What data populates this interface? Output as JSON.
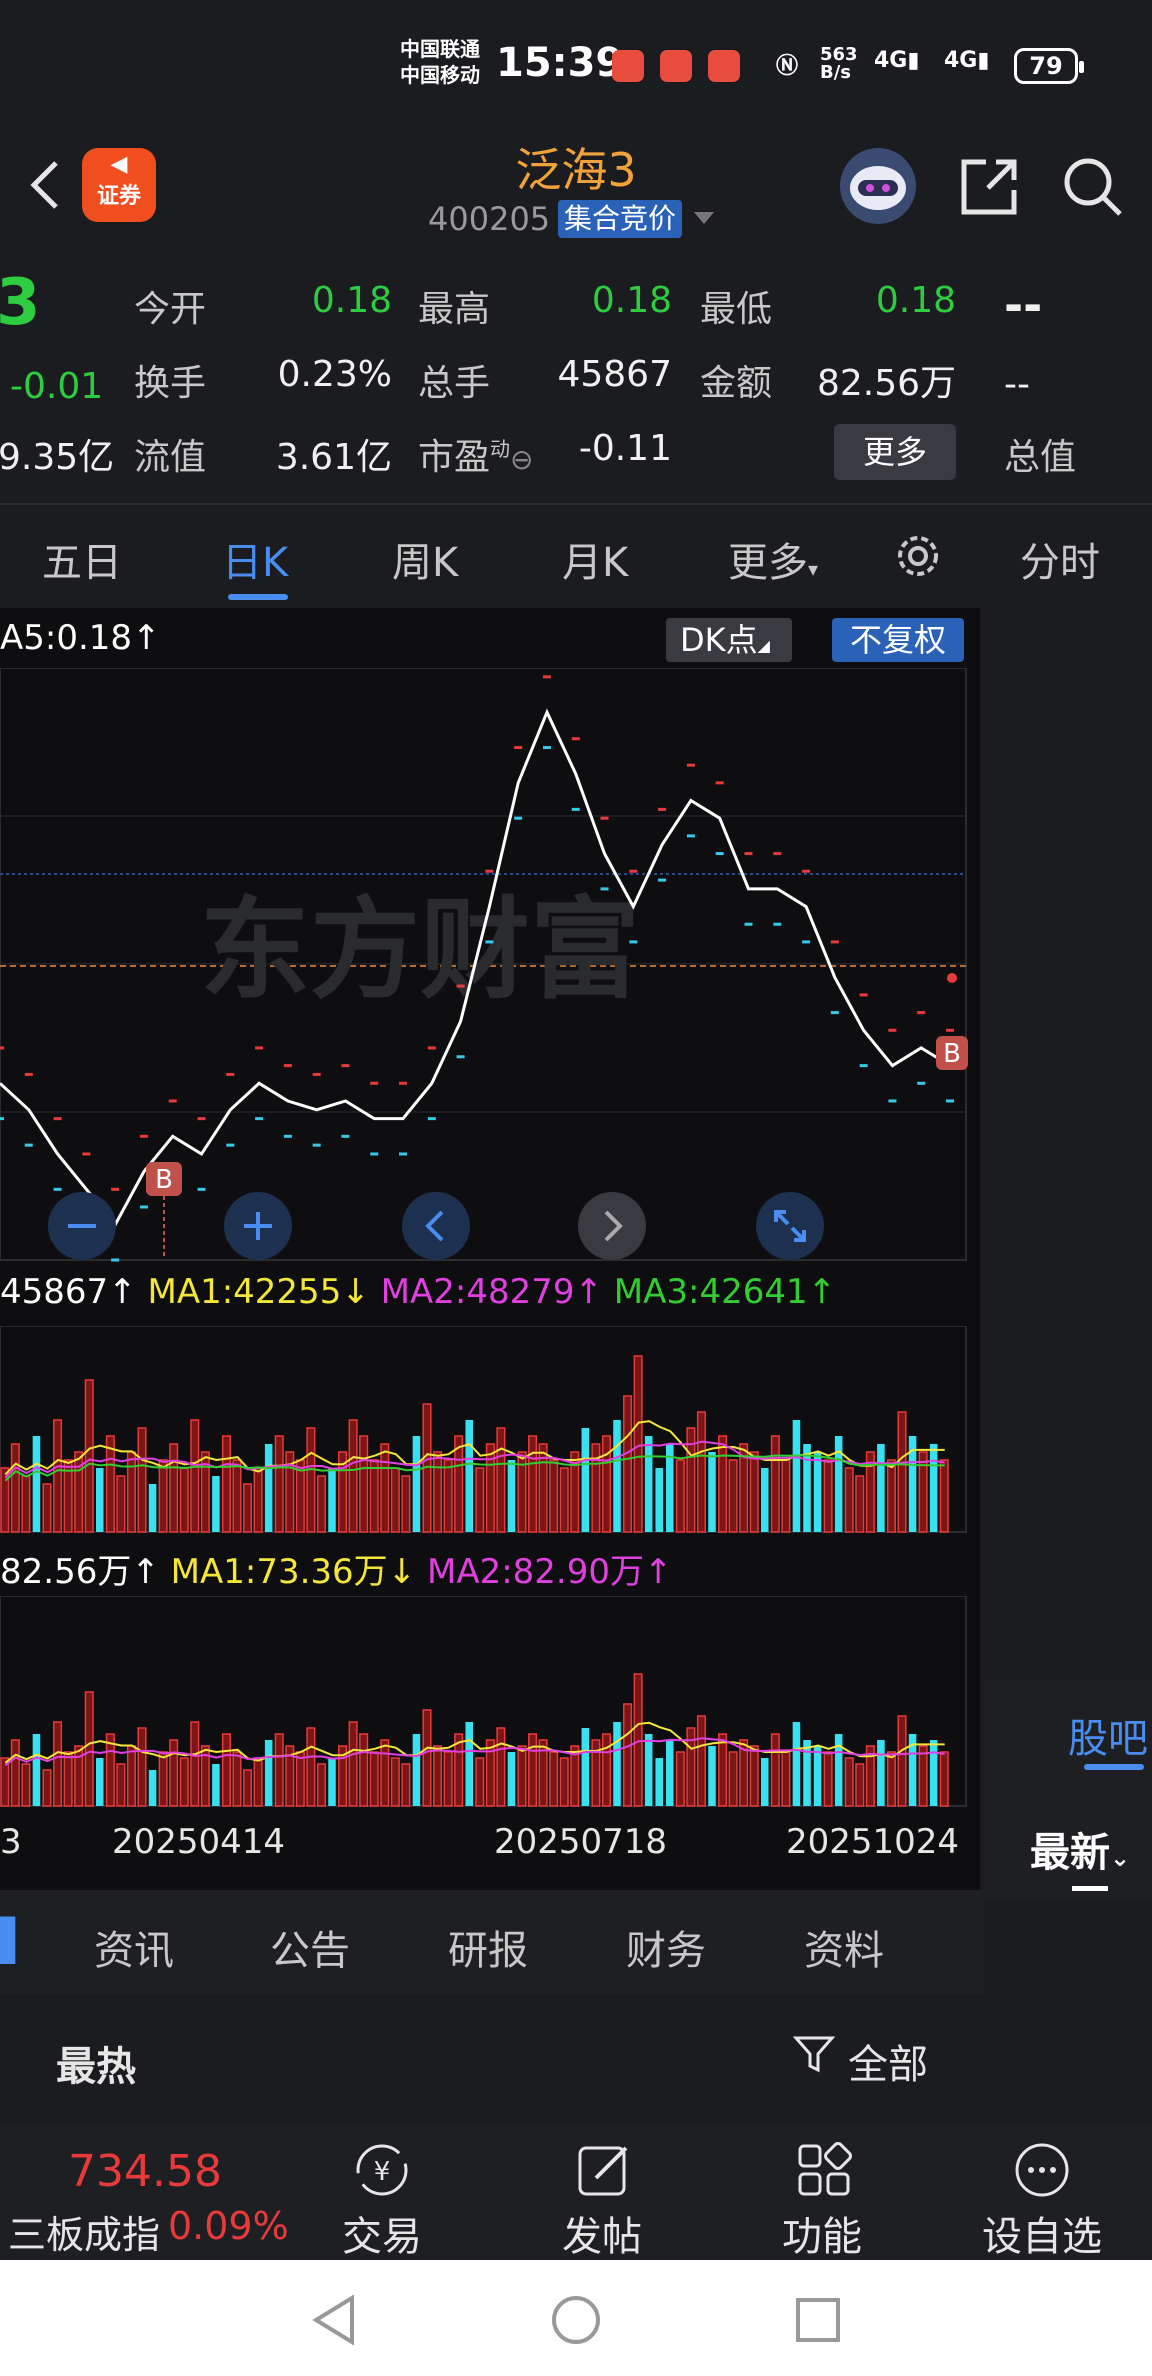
{
  "status_bar": {
    "carrier1": "中国联通",
    "carrier2": "中国移动",
    "time": "15:39",
    "net_speed_top": "563",
    "net_speed_bottom": "B/s",
    "signal1": "4G",
    "signal2": "4G",
    "battery": "79"
  },
  "header": {
    "app_logo_label": "证券",
    "stock_name": "泛海3",
    "stock_code": "400205",
    "stock_tag": "集合竞价"
  },
  "quote": {
    "price_partial": "3",
    "change_partial": "-0.01",
    "cap_partial": "9.35亿",
    "open_label": "今开",
    "open_value": "0.18",
    "high_label": "最高",
    "high_value": "0.18",
    "low_label": "最低",
    "low_value": "0.18",
    "turnover_label": "换手",
    "turnover_value": "0.23%",
    "volume_label": "总手",
    "volume_value": "45867",
    "amount_label": "金额",
    "amount_value": "82.56万",
    "float_label": "流值",
    "float_value": "3.61亿",
    "pe_label": "市盈",
    "pe_superscript": "动",
    "pe_value": "-0.11",
    "more_label": "更多",
    "right_top": "--",
    "right_mid": "--",
    "total_value_label": "总值"
  },
  "chart_tabs": {
    "tabs": [
      "五日",
      "日K",
      "周K",
      "月K",
      "更多",
      "分时"
    ],
    "active": "日K"
  },
  "kline": {
    "ma_line": "A5:0.18",
    "dk_label": "DK点",
    "fq_label": "不复权",
    "watermark": "东方财富",
    "buy_marker": "B",
    "close_values": [
      0.178,
      0.175,
      0.17,
      0.166,
      0.162,
      0.168,
      0.172,
      0.17,
      0.175,
      0.178,
      0.176,
      0.175,
      0.176,
      0.174,
      0.174,
      0.178,
      0.185,
      0.198,
      0.212,
      0.22,
      0.213,
      0.204,
      0.198,
      0.205,
      0.21,
      0.208,
      0.2,
      0.2,
      0.198,
      0.19,
      0.184,
      0.18,
      0.182,
      0.18
    ]
  },
  "volume": {
    "header": {
      "vol": "45867",
      "ma1": "MA1:42255",
      "ma2": "MA2:48279",
      "ma3": "MA3:42641"
    },
    "colors": {
      "ma1": "#f5e63b",
      "ma2": "#e040e0",
      "ma3": "#33cc33"
    }
  },
  "amount": {
    "header": {
      "amt": "82.56万",
      "ma1": "MA1:73.36万",
      "ma2": "MA2:82.90万"
    }
  },
  "dates": {
    "left_partial": "3",
    "d1": "20250414",
    "d2": "20250718",
    "d3": "20251024"
  },
  "side": {
    "tab": "股吧",
    "sort": "最新"
  },
  "info_tabs": {
    "partial": "▌",
    "tabs": [
      "资讯",
      "公告",
      "研报",
      "财务",
      "资料"
    ]
  },
  "hot": {
    "title": "最热",
    "filter_label": "全部"
  },
  "bottom_bar": {
    "index_value": "734.58",
    "index_name": "三板成指",
    "index_pct": "0.09%",
    "items": [
      "交易",
      "发帖",
      "功能",
      "设自选"
    ]
  },
  "colors": {
    "up": "#e83a3a",
    "down": "#2ecc40",
    "accent": "#4a8df0",
    "brand": "#f2a23a"
  }
}
